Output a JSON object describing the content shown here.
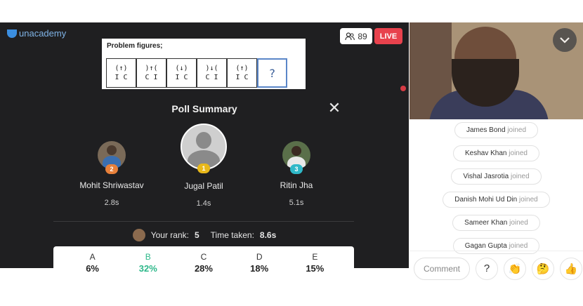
{
  "brand": {
    "name": "unacademy",
    "accent": "#3b8ee0"
  },
  "problem": {
    "title": "Problem figures;",
    "figures": [
      {
        "top": "(↑)",
        "bottom": "I C"
      },
      {
        "top": ")↑(",
        "bottom": "C I"
      },
      {
        "top": "(↓)",
        "bottom": "I C"
      },
      {
        "top": ")↓(",
        "bottom": "C I"
      },
      {
        "top": "(↑)",
        "bottom": "I C"
      },
      {
        "top": "?",
        "bottom": ""
      }
    ]
  },
  "header": {
    "viewer_count": "89",
    "live_label": "LIVE",
    "live_color": "#e8424d"
  },
  "poll": {
    "title": "Poll Summary",
    "close_icon": "close-icon",
    "players": [
      {
        "rank": "2",
        "name": "Mohit Shriwastav",
        "time": "2.8s",
        "badge_color": "#e8803a"
      },
      {
        "rank": "1",
        "name": "Jugal Patil",
        "time": "1.4s",
        "badge_color": "#e8b81a"
      },
      {
        "rank": "3",
        "name": "Ritin Jha",
        "time": "5.1s",
        "badge_color": "#2fb8c8"
      }
    ],
    "your_rank_label": "Your rank:",
    "your_rank": "5",
    "time_taken_label": "Time taken:",
    "time_taken": "8.6s",
    "options": [
      {
        "letter": "A",
        "pct": "6%"
      },
      {
        "letter": "B",
        "pct": "32%",
        "correct": true
      },
      {
        "letter": "C",
        "pct": "28%"
      },
      {
        "letter": "D",
        "pct": "18%"
      },
      {
        "letter": "E",
        "pct": "15%"
      }
    ],
    "correct_color": "#2db88a"
  },
  "joins": [
    {
      "name": "James Bond",
      "status": "joined"
    },
    {
      "name": "Keshav Khan",
      "status": "joined"
    },
    {
      "name": "Vishal Jasrotia",
      "status": "joined"
    },
    {
      "name": "Danish Mohi Ud Din",
      "status": "joined"
    },
    {
      "name": "Sameer Khan",
      "status": "joined"
    },
    {
      "name": "Gagan Gupta",
      "status": "joined"
    }
  ],
  "chat": {
    "comment_placeholder": "Comment",
    "icons": [
      "help-icon",
      "clap-emoji-icon",
      "thinking-emoji-icon",
      "thumbs-up-emoji-icon"
    ]
  }
}
